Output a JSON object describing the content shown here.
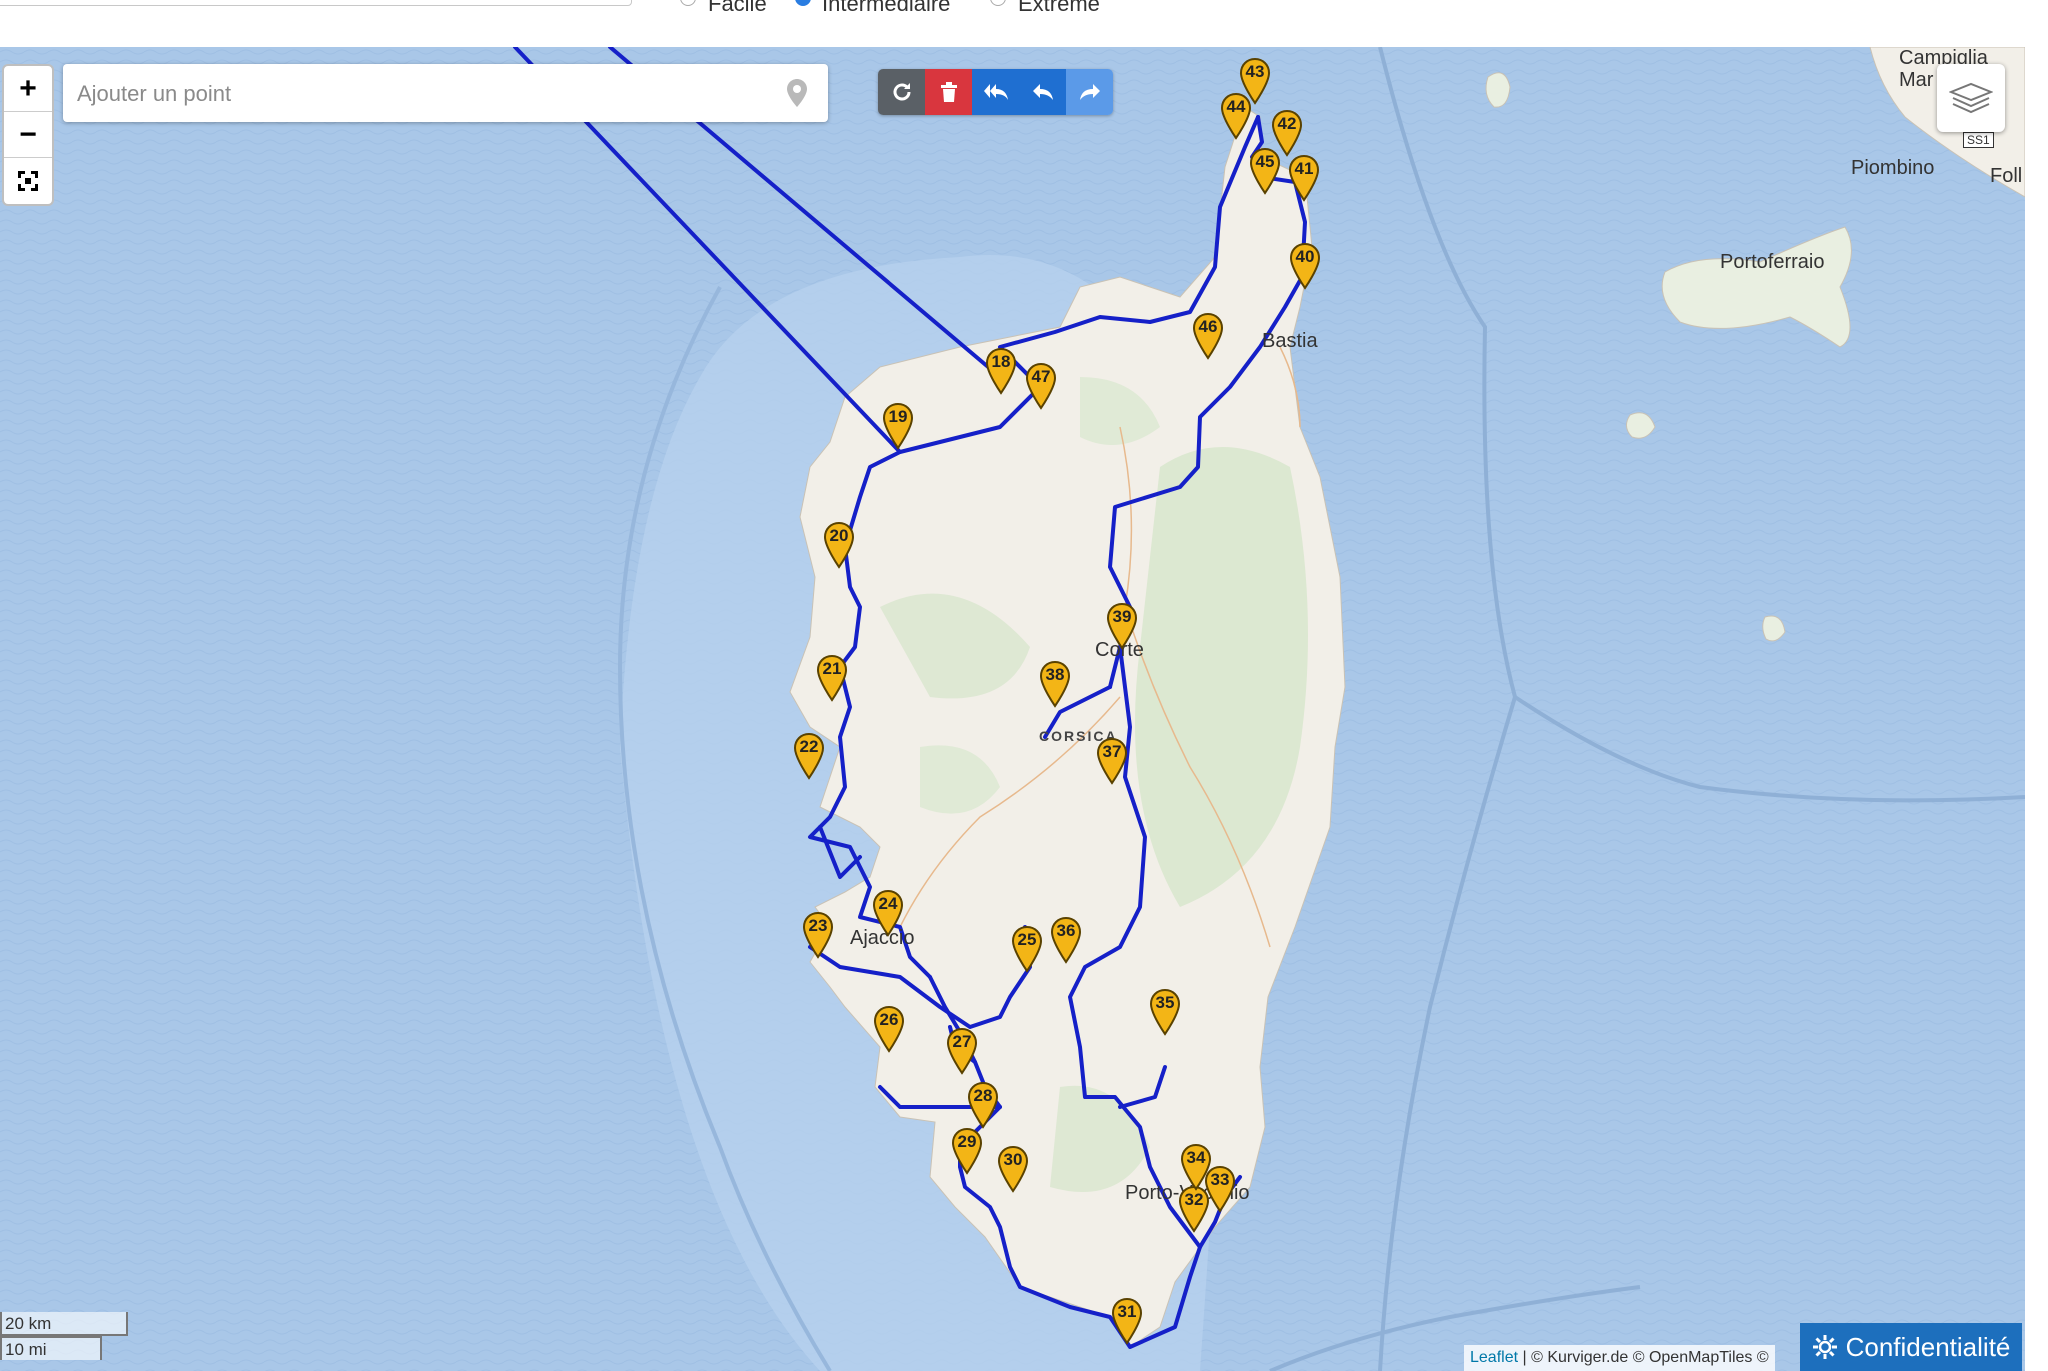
{
  "top": {
    "options": [
      "Facile",
      "Intermédiaire",
      "Extrême"
    ],
    "selected": "Intermédiaire"
  },
  "zoom": {
    "in": "+",
    "out": "−",
    "fit": "⛶"
  },
  "search": {
    "placeholder": "Ajouter un point",
    "value": ""
  },
  "toolbar": {
    "buttons": [
      {
        "name": "refresh",
        "icon": "refresh-icon",
        "color": "#5a6066"
      },
      {
        "name": "delete",
        "icon": "trash-icon",
        "color": "#d9363e"
      },
      {
        "name": "undo-all",
        "icon": "reply-all-icon",
        "color": "#1f6fd1"
      },
      {
        "name": "undo",
        "icon": "reply-icon",
        "color": "#1f6fd1"
      },
      {
        "name": "redo",
        "icon": "forward-icon",
        "color": "#5b9ae8"
      }
    ]
  },
  "labels": {
    "campiglia": "Campiglia",
    "mar": "Mar",
    "piombino": "Piombino",
    "foll": "Foll",
    "portoferraio": "Portoferraio",
    "bastia": "Bastia",
    "corte": "Corte",
    "corsica": "CORSICA",
    "ajaccio": "Ajaccio",
    "porto": "Porto-Vecchio",
    "ss1": "SS1"
  },
  "markers": [
    "18",
    "19",
    "20",
    "21",
    "22",
    "23",
    "24",
    "25",
    "26",
    "27",
    "28",
    "29",
    "30",
    "31",
    "32",
    "33",
    "34",
    "35",
    "36",
    "37",
    "38",
    "39",
    "40",
    "41",
    "42",
    "43",
    "44",
    "45",
    "46",
    "47"
  ],
  "scale": {
    "km": "20 km",
    "mi": "10 mi"
  },
  "attribution": {
    "leaflet": "Leaflet",
    "rest": " | © Kurviger.de © OpenMapTiles ©"
  },
  "privacy": {
    "label": "Confidentialité"
  },
  "colors": {
    "route": "#1520c8",
    "sea": "#a9c7e8",
    "land": "#f2efe8",
    "marker": "#f3b516"
  }
}
